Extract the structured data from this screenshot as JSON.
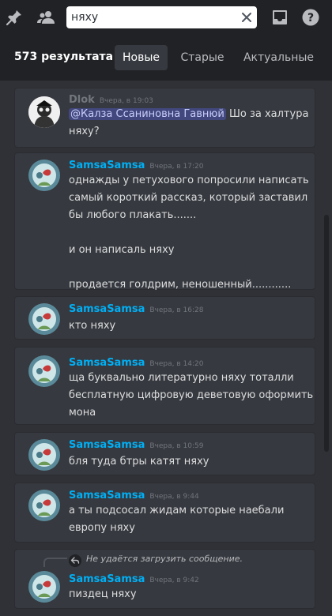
{
  "toolbar": {
    "search_value": "няху",
    "icons": [
      "pin-icon",
      "members-icon",
      "close-icon",
      "inbox-icon",
      "help-icon"
    ]
  },
  "filter": {
    "count_label": "573 результата",
    "tabs": [
      {
        "label": "Новые",
        "active": true
      },
      {
        "label": "Старые",
        "active": false
      },
      {
        "label": "Актуальные",
        "active": false
      }
    ]
  },
  "colors": {
    "accent_username": "#00aff4",
    "mention_bg": "#5865f2"
  },
  "results": [
    {
      "author": "Dlok",
      "timestamp": "Вчера, в 19:03",
      "mention": "@Калза Ссаниновна Гавнюй",
      "lines": [
        "Шо за халтура",
        "няху?"
      ]
    },
    {
      "author": "SamsaSamsa",
      "timestamp": "Вчера, в 17:20",
      "lines": [
        "однажды у петухового попросили написать",
        "самый короткий рассказ, который заставил",
        "бы любого плакать.......",
        "",
        "и он написаль няху",
        "",
        "продается голдрим, неношенный............"
      ]
    },
    {
      "author": "SamsaSamsa",
      "timestamp": "Вчера, в 16:28",
      "lines": [
        "кто няху"
      ]
    },
    {
      "author": "SamsaSamsa",
      "timestamp": "Вчера, в 14:20",
      "lines": [
        "ща буквально литературно няху тоталли",
        "бесплатную цифровую деветовую оформить",
        "мона"
      ]
    },
    {
      "author": "SamsaSamsa",
      "timestamp": "Вчера, в 10:59",
      "lines": [
        "бля туда бтры катят няху"
      ]
    },
    {
      "author": "SamsaSamsa",
      "timestamp": "Вчера, в 9:44",
      "lines": [
        "а ты подсосал жидам которые наебали",
        "европу няху"
      ]
    },
    {
      "reply_notice": "Не удаётся загрузить сообщение.",
      "author": "SamsaSamsa",
      "timestamp": "Вчера, в 9:42",
      "lines": [
        "пиздец няху"
      ]
    }
  ]
}
